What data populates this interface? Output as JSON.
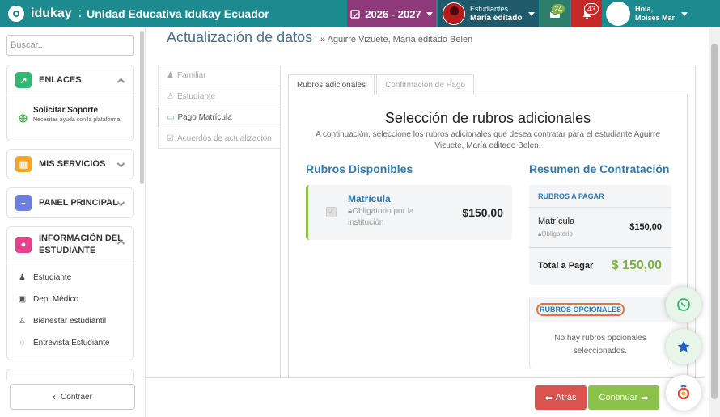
{
  "topbar": {
    "brand": "idukay",
    "separator": ":",
    "school": "Unidad Educativa Idukay Ecuador",
    "year": "2026 - 2027",
    "student_label": "Estudiantes",
    "student_name": "María editado",
    "messages_count": "24",
    "notifications_count": "43",
    "greeting": "Hola,",
    "user_name": "Moises Mar"
  },
  "sidebar": {
    "search_placeholder": "Buscar...",
    "enlaces": {
      "title": "ENLACES",
      "item_title": "Solicitar Soporte",
      "item_sub": "Necesitas ayuda con la plataforma",
      "color": "#2eb872"
    },
    "mis_servicios": {
      "title": "MIS SERVICIOS",
      "color": "#f5a623"
    },
    "panel_principal": {
      "title": "PANEL PRINCIPAL",
      "color": "#6c7fe0"
    },
    "info_estudiante": {
      "title_l1": "INFORMACIÓN DEL",
      "title_l2": "ESTUDIANTE",
      "color": "#e8408c",
      "items": [
        "Estudiante",
        "Dep. Médico",
        "Bienestar estudiantil",
        "Entrevista Estudiante"
      ]
    },
    "collapse_label": "Contraer"
  },
  "main": {
    "title": "Actualización de datos",
    "breadcrumb": "» Aguirre Vizuete, María editado Belen",
    "vtabs": [
      "Familiar",
      "Estudiante",
      "Pago Matrícula",
      "Acuerdos de actualización"
    ],
    "htabs": [
      "Rubros adicionales",
      "Confirmación de Pago"
    ],
    "heading": "Selección de rubros adicionales",
    "subheading_l1": "A continuación, seleccione los rubros adicionales que desea contratar para el estudiante Aguirre",
    "subheading_l2": "Vizuete, María editado Belen.",
    "available_title": "Rubros Disponibles",
    "item_name": "Matrícula",
    "item_note_l1": "Obligatorio por la",
    "item_note_l2": "institución",
    "item_price": "$150,00",
    "summary_title": "Resumen de Contratación",
    "to_pay_title": "RUBROS A PAGAR",
    "summary_item": "Matrícula",
    "summary_item_note": "Obligatorio",
    "summary_item_price": "$150,00",
    "total_label": "Total a Pagar",
    "total_value": "$ 150,00",
    "optional_title": "RUBROS OPCIONALES",
    "optional_empty_l1": "No hay rubros opcionales",
    "optional_empty_l2": "seleccionados."
  },
  "footer": {
    "back_label": "Atrás",
    "next_label": "Continuar"
  },
  "colors": {
    "topbar": "#1d8a8f",
    "accent_blue": "#2e77b5",
    "success": "#8bc34a",
    "danger": "#d9534f"
  }
}
